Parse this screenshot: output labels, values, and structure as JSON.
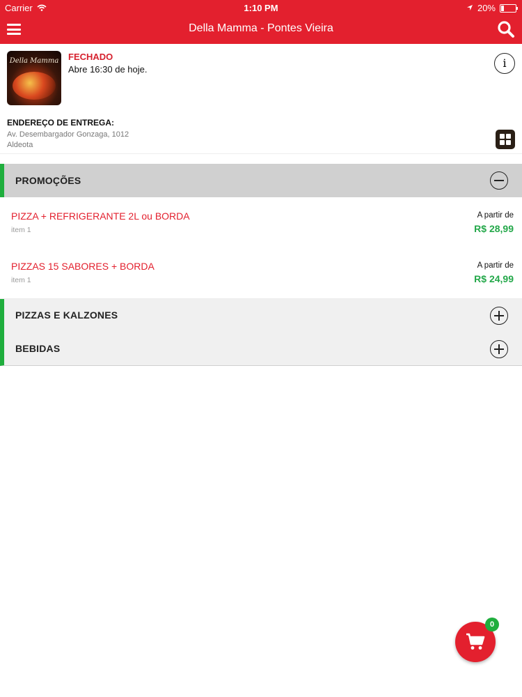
{
  "status_bar": {
    "carrier": "Carrier",
    "time": "1:10 PM",
    "battery": "20%",
    "battery_level": 0.2
  },
  "nav": {
    "title": "Della Mamma - Pontes Vieira"
  },
  "restaurant": {
    "logo_text": "Della Mamma",
    "status": "FECHADO",
    "opening": "Abre 16:30 de hoje.",
    "address_label": "ENDEREÇO DE ENTREGA:",
    "address_line1": "Av. Desembargador Gonzaga, 1012",
    "address_line2": "Aldeota"
  },
  "sections": [
    {
      "label": "PROMOÇÕES",
      "expanded": true
    },
    {
      "label": "PIZZAS E KALZONES",
      "expanded": false
    },
    {
      "label": "BEBIDAS",
      "expanded": false
    }
  ],
  "items": [
    {
      "name": "PIZZA + REFRIGERANTE 2L ou BORDA",
      "subtitle": "item 1",
      "from_label": "A partir de",
      "price": "R$ 28,99"
    },
    {
      "name": "PIZZAS 15 SABORES + BORDA",
      "subtitle": "item 1",
      "from_label": "A partir de",
      "price": "R$ 24,99"
    }
  ],
  "cart": {
    "count": "0"
  },
  "colors": {
    "brand_red": "#e3202e",
    "accent_green": "#1fae3d",
    "price_green": "#24a84a"
  }
}
